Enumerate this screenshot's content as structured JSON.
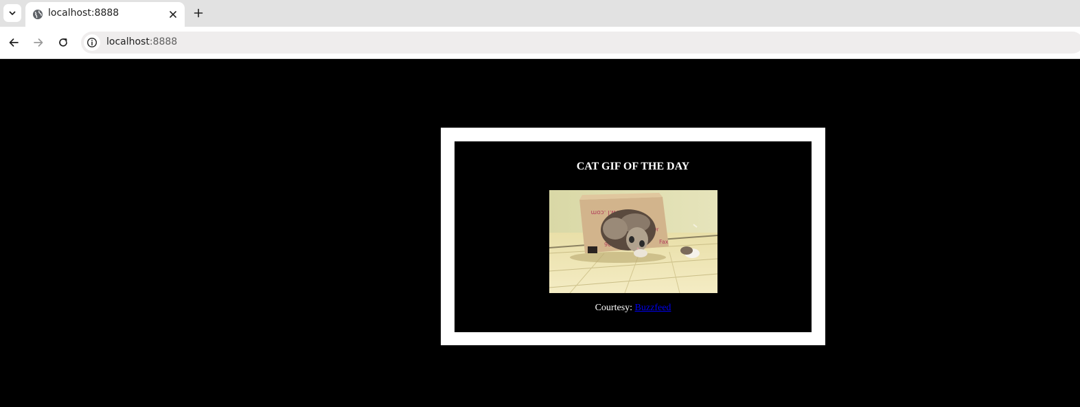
{
  "browser": {
    "tab": {
      "title": "localhost:8888",
      "favicon": "globe-icon"
    },
    "address_bar": {
      "host": "localhost",
      "port": ":8888"
    },
    "icons": {
      "tab_search": "chevron-down-icon",
      "close_tab": "close-icon",
      "new_tab": "plus-icon",
      "back": "arrow-left-icon",
      "forward": "arrow-right-icon",
      "reload": "reload-icon",
      "site_info": "info-icon"
    }
  },
  "page": {
    "background": "#000000",
    "card": {
      "title": "CAT GIF OF THE DAY",
      "image": "cat-in-box-image",
      "caption_prefix": "Courtesy:",
      "caption_link": "Buzzfeed",
      "link_color": "#0000ee"
    }
  }
}
